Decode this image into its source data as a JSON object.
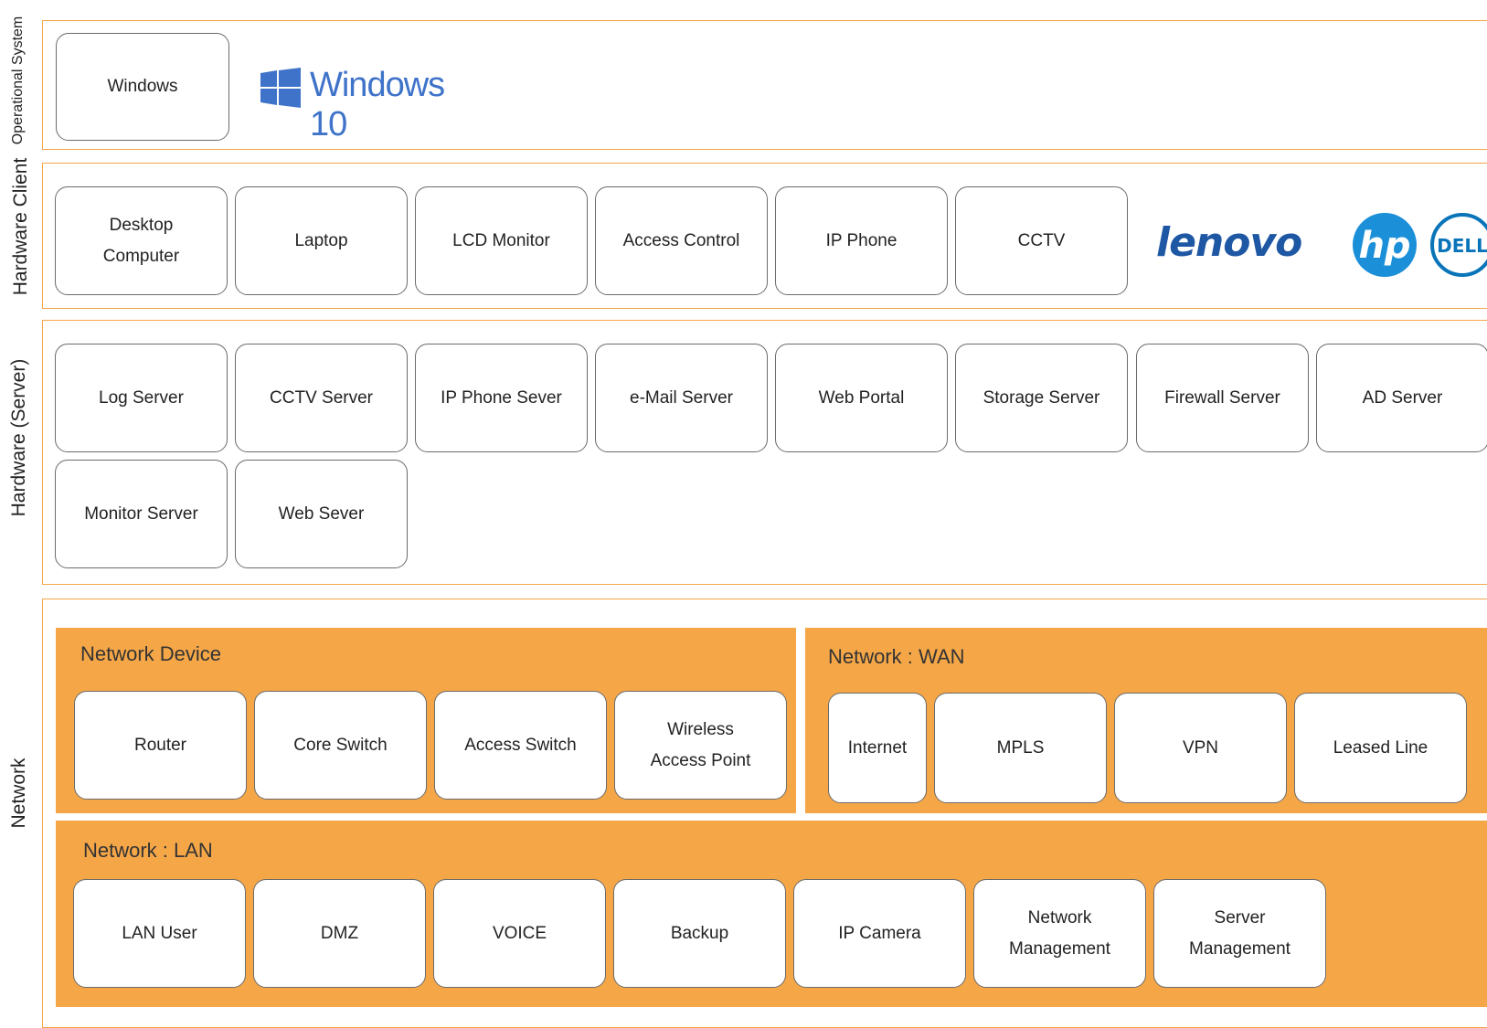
{
  "side_labels": {
    "operational_system": "Operational System",
    "hardware_client": "Hardware Client",
    "hardware_server": "Hardware (Server)",
    "network": "Network"
  },
  "os": {
    "box": "Windows",
    "logo_text": "Windows 10"
  },
  "client": {
    "boxes": [
      "Desktop\nComputer",
      "Laptop",
      "LCD Monitor",
      "Access Control",
      "IP Phone",
      "CCTV"
    ],
    "logos": {
      "lenovo": "lenovo",
      "hp": "hp",
      "dell": "DELL"
    }
  },
  "server": {
    "boxes": [
      "Log Server",
      "CCTV Server",
      "IP Phone Sever",
      "e-Mail Server",
      "Web Portal",
      "Storage Server",
      "Firewall Server",
      "AD Server",
      "Monitor Server",
      "Web Sever"
    ]
  },
  "network_device": {
    "title": "Network Device",
    "boxes": [
      "Router",
      "Core Switch",
      "Access Switch",
      "Wireless\nAccess Point"
    ]
  },
  "network_wan": {
    "title": "Network : WAN",
    "boxes": [
      "Internet",
      "MPLS",
      "VPN",
      "Leased Line"
    ]
  },
  "network_lan": {
    "title": "Network : LAN",
    "boxes": [
      "LAN User",
      "DMZ",
      "VOICE",
      "Backup",
      "IP Camera",
      "Network\nManagement",
      "Server\nManagement"
    ]
  },
  "colors": {
    "accent_orange": "#f5a748",
    "border_orange": "#f5a54a",
    "windows_blue": "#3f73c9",
    "lenovo_blue": "#1e57a3",
    "hp_blue": "#1b8fd8",
    "dell_blue": "#0a74b9"
  }
}
